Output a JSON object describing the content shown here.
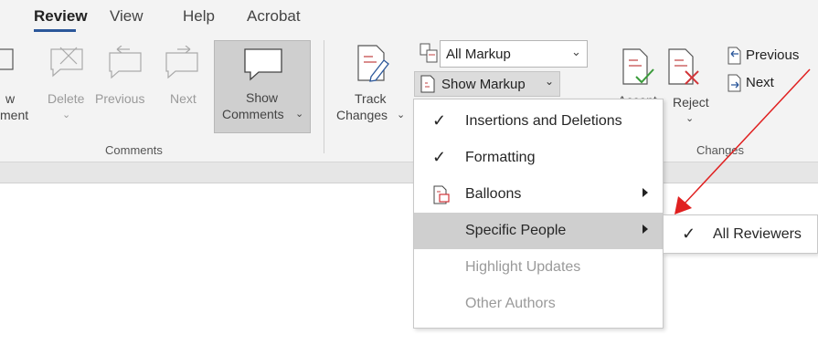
{
  "tabs": [
    {
      "label": "Review",
      "active": true
    },
    {
      "label": "View"
    },
    {
      "label": "Help"
    },
    {
      "label": "Acrobat"
    }
  ],
  "comments_group": {
    "new_label_line1": "w",
    "new_label_line2": "ment",
    "delete_label": "Delete",
    "previous_label": "Previous",
    "next_label": "Next",
    "show_label_line1": "Show",
    "show_label_line2": "Comments",
    "group_label": "Comments"
  },
  "tracking_group": {
    "track_label_line1": "Track",
    "track_label_line2": "Changes",
    "markup_value": "All Markup",
    "show_markup_label": "Show Markup"
  },
  "changes_group": {
    "accept_label": "Accept",
    "reject_label": "Reject",
    "previous_label": "Previous",
    "next_label": "Next",
    "group_label": "Changes"
  },
  "show_markup_menu": [
    {
      "label": "Insertions and Deletions",
      "checked": true,
      "enabled": true
    },
    {
      "label": "Formatting",
      "checked": true,
      "enabled": true
    },
    {
      "label": "Balloons",
      "submenu": true,
      "enabled": true
    },
    {
      "label": "Specific People",
      "submenu": true,
      "enabled": true,
      "highlighted": true
    },
    {
      "label": "Highlight Updates",
      "enabled": false
    },
    {
      "label": "Other Authors",
      "enabled": false
    }
  ],
  "specific_people_submenu": [
    {
      "label": "All Reviewers",
      "checked": true
    }
  ],
  "colors": {
    "accent": "#2b579a",
    "annotation_arrow": "#e02020",
    "reject_x": "#d13438",
    "icon_green": "#3a9b3a"
  }
}
